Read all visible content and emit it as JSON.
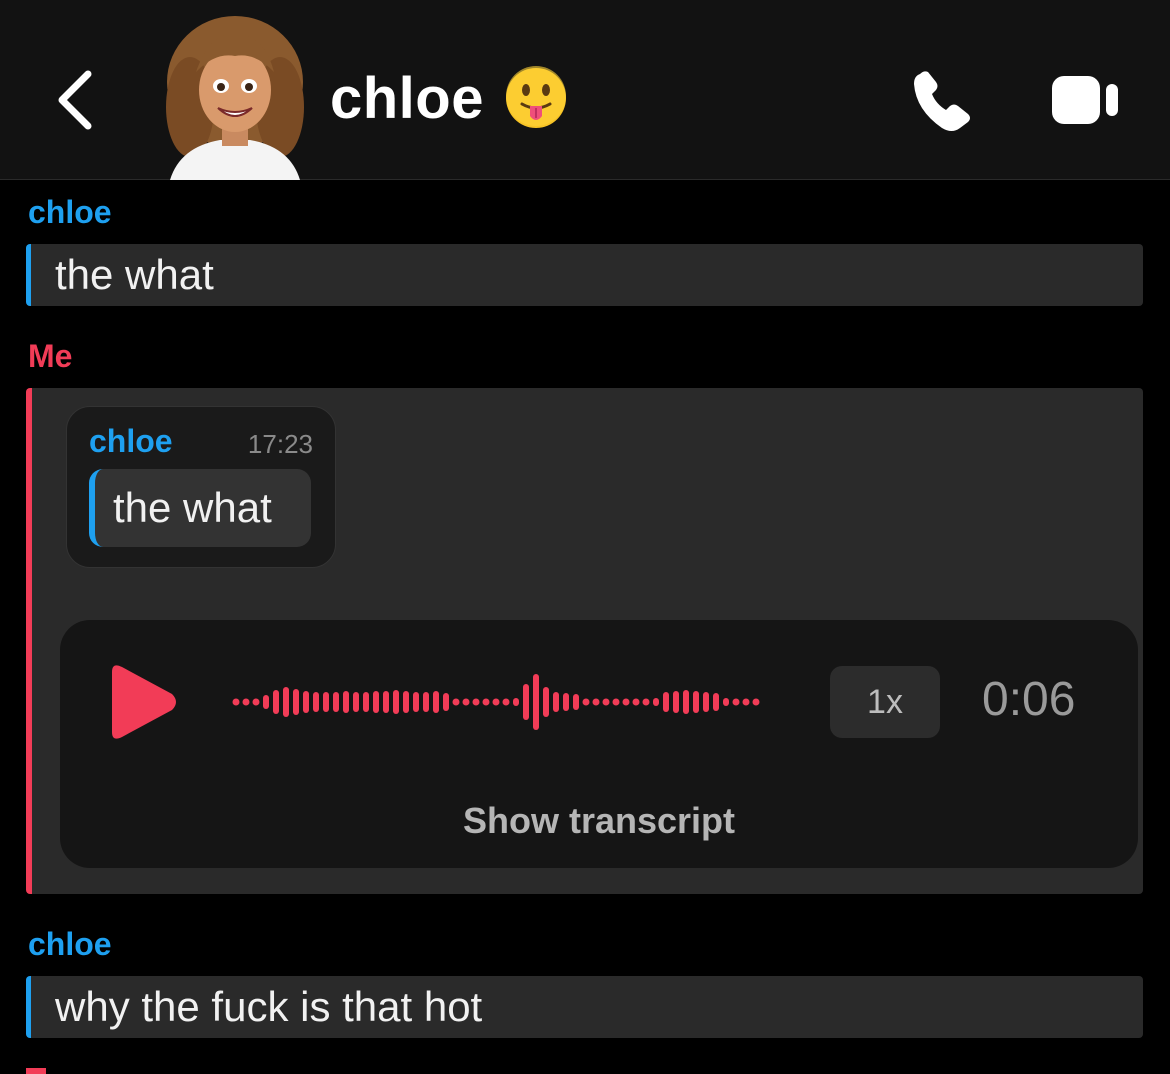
{
  "header": {
    "contact_name": "chloe",
    "status_emoji": "😛",
    "back_icon": "chevron-left-icon",
    "call_icon": "phone-icon",
    "video_icon": "video-camera-icon"
  },
  "colors": {
    "friend_accent": "#1ea0f0",
    "me_accent": "#f23c57",
    "bubble_bg": "#2a2a2a",
    "background": "#000000"
  },
  "messages": [
    {
      "sender": "chloe",
      "text": "the what"
    },
    {
      "sender": "Me",
      "reply_to": {
        "sender": "chloe",
        "time": "17:23",
        "text": "the what"
      },
      "voice_note": {
        "play_icon": "play-icon",
        "speed": "1x",
        "duration": "0:06",
        "transcript_label": "Show transcript"
      }
    },
    {
      "sender": "chloe",
      "text": "why the fuck is that hot"
    }
  ]
}
